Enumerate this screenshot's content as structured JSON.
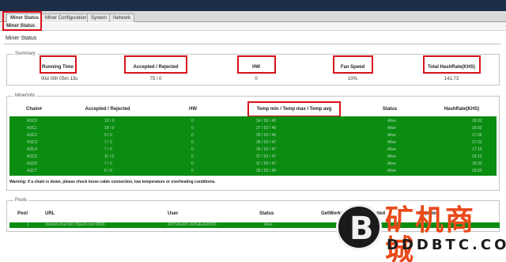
{
  "tabs": [
    "Miner Status",
    "Miner Configuration",
    "System",
    "Network"
  ],
  "subtab": "Miner Status",
  "page_title": "Miner Status",
  "summary": {
    "legend": "Summary",
    "headers": [
      "Running Time",
      "Accepted / Rejected",
      "HW",
      "Fan Speed",
      "Total HashRate(KHS)"
    ],
    "values": [
      "00d 00h 05m 13s",
      "75 / 0",
      "0",
      "10%",
      "141.73"
    ]
  },
  "minerinfo": {
    "legend": "MinerInfo",
    "headers": [
      "Chain#",
      "Accepted / Rejected",
      "HW",
      "Temp min / Temp max / Temp avg",
      "Status",
      "HashRate(KHS)"
    ],
    "rows": [
      [
        "ASC0",
        "10 / 0",
        "0",
        "34 / 50 / 45",
        "Alive",
        "18.02"
      ],
      [
        "ASC1",
        "18 / 0",
        "0",
        "37 / 52 / 46",
        "Alive",
        "18.63"
      ],
      [
        "ASC2",
        "9 / 0",
        "0",
        "36 / 52 / 46",
        "Alive",
        "17.66"
      ],
      [
        "ASC3",
        "7 / 0",
        "0",
        "36 / 53 / 47",
        "Alive",
        "17.93"
      ],
      [
        "ASC4",
        "7 / 0",
        "0",
        "35 / 53 / 47",
        "Alive",
        "17.16"
      ],
      [
        "ASC5",
        "11 / 0",
        "0",
        "37 / 53 / 47",
        "Alive",
        "18.15"
      ],
      [
        "ASC6",
        "7 / 0",
        "0",
        "37 / 54 / 47",
        "Alive",
        "18.30"
      ],
      [
        "ASC7",
        "6 / 0",
        "0",
        "35 / 52 / 46",
        "Alive",
        "18.80"
      ]
    ],
    "warning": "Warning: if a chain is down, please check loose cable connection, low temperature or overheating conditions."
  },
  "pools": {
    "legend": "Pools",
    "headers": [
      "Pool",
      "URL",
      "User",
      "Status",
      "GetWorks",
      "Accepted",
      "Rejected"
    ],
    "row": [
      "1",
      "stratum+tcp://dcr.f2pool.com:3800",
      "ADYeKaAYLzEBaEaKAHZF",
      "Alive",
      "",
      "",
      ""
    ]
  },
  "watermark": {
    "cn": "矿机商城",
    "en": "DDDBTC.COM"
  }
}
